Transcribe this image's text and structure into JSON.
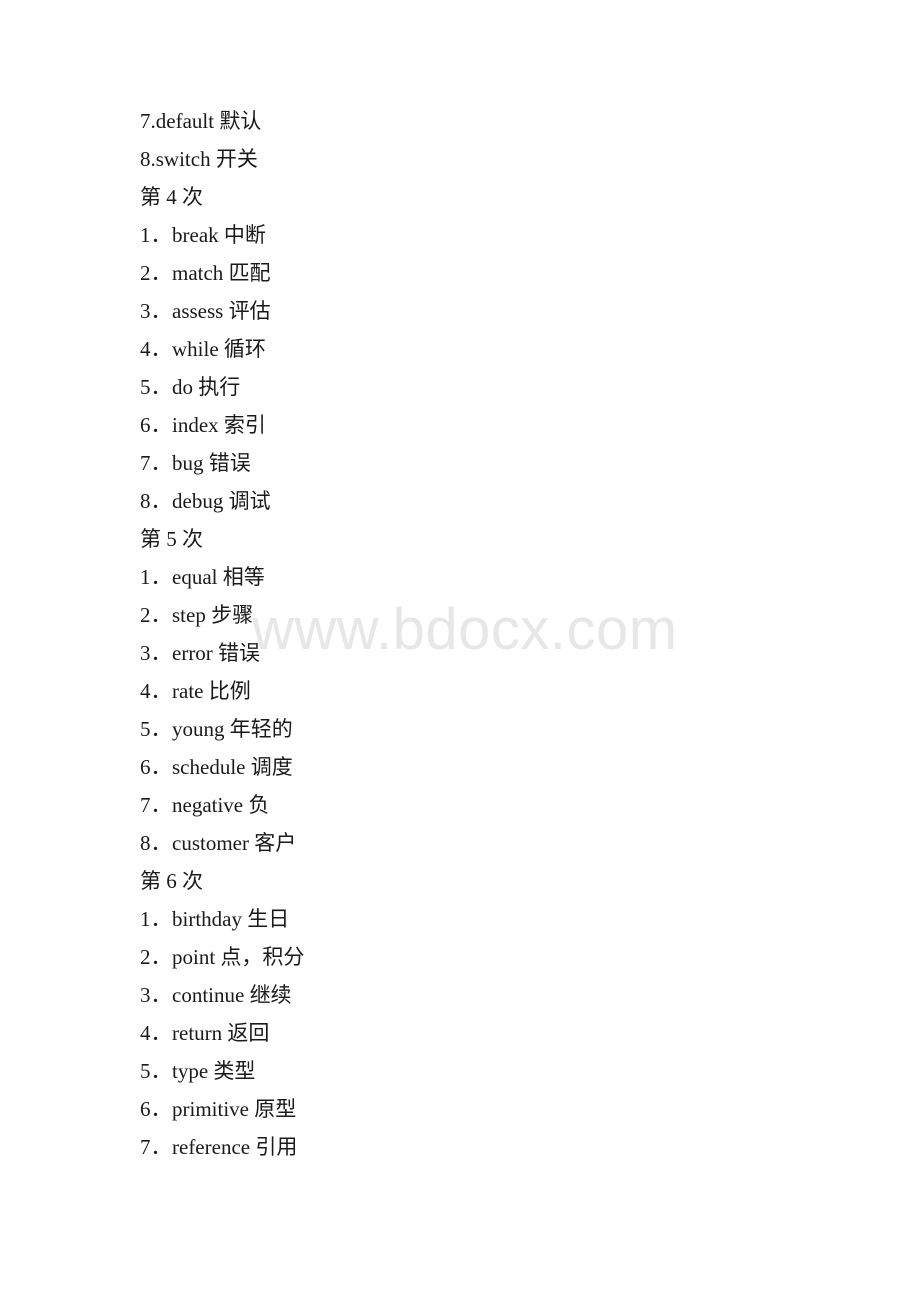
{
  "watermark": {
    "text": "www.bdocx.com"
  },
  "page": {
    "lines": [
      {
        "kind": "compact",
        "num": "7.",
        "term": "default",
        "gloss": "默认"
      },
      {
        "kind": "compact",
        "num": "8.",
        "term": "switch",
        "gloss": "开关"
      },
      {
        "kind": "heading",
        "text": "第 4 次"
      },
      {
        "kind": "item",
        "num": "1．",
        "term": "break",
        "gloss": "中断"
      },
      {
        "kind": "item",
        "num": "2．",
        "term": "match",
        "gloss": "匹配"
      },
      {
        "kind": "item",
        "num": "3．",
        "term": "assess",
        "gloss": "评估"
      },
      {
        "kind": "item",
        "num": "4．",
        "term": "while",
        "gloss": "循环"
      },
      {
        "kind": "item",
        "num": "5．",
        "term": "do",
        "gloss": "执行"
      },
      {
        "kind": "item",
        "num": "6．",
        "term": "index",
        "gloss": "索引"
      },
      {
        "kind": "item",
        "num": "7．",
        "term": "bug",
        "gloss": "错误"
      },
      {
        "kind": "item",
        "num": "8．",
        "term": "debug",
        "gloss": "调试"
      },
      {
        "kind": "heading",
        "text": "第 5 次"
      },
      {
        "kind": "item",
        "num": "1．",
        "term": "equal",
        "gloss": "相等"
      },
      {
        "kind": "item",
        "num": "2．",
        "term": "step",
        "gloss": "步骤"
      },
      {
        "kind": "item",
        "num": "3．",
        "term": "error",
        "gloss": "错误"
      },
      {
        "kind": "item",
        "num": "4．",
        "term": "rate",
        "gloss": "比例"
      },
      {
        "kind": "item",
        "num": "5．",
        "term": "young",
        "gloss": "年轻的"
      },
      {
        "kind": "item",
        "num": "6．",
        "term": "schedule",
        "gloss": "调度"
      },
      {
        "kind": "item",
        "num": "7．",
        "term": "negative",
        "gloss": "负"
      },
      {
        "kind": "item",
        "num": "8．",
        "term": "customer",
        "gloss": "客户"
      },
      {
        "kind": "heading",
        "text": "第 6 次"
      },
      {
        "kind": "item",
        "num": "1．",
        "term": "birthday",
        "gloss": "生日"
      },
      {
        "kind": "item",
        "num": "2．",
        "term": "point",
        "gloss": "点，积分"
      },
      {
        "kind": "item",
        "num": "3．",
        "term": "continue",
        "gloss": "继续"
      },
      {
        "kind": "item",
        "num": "4．",
        "term": "return",
        "gloss": "返回"
      },
      {
        "kind": "item",
        "num": "5．",
        "term": "type",
        "gloss": "类型"
      },
      {
        "kind": "item",
        "num": "6．",
        "term": "primitive",
        "gloss": "原型"
      },
      {
        "kind": "item",
        "num": "7．",
        "term": "reference",
        "gloss": "引用"
      }
    ]
  }
}
